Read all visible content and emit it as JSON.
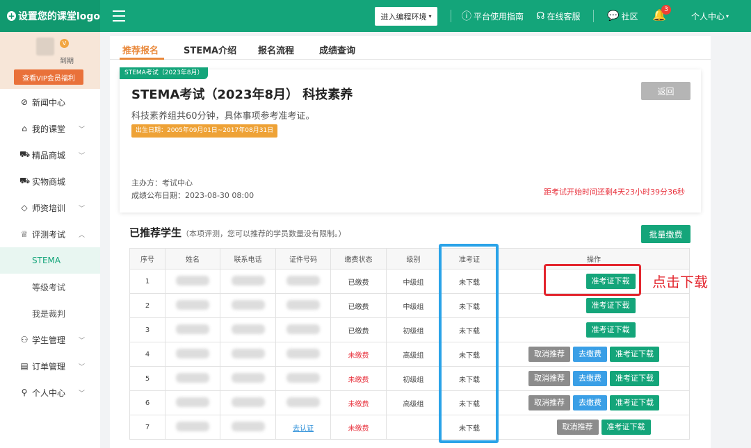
{
  "logo": {
    "text": "设置您的课堂logo"
  },
  "header": {
    "env_button": "进入编程环境",
    "guide": "平台使用指南",
    "service": "在线客服",
    "community": "社区",
    "notify_count": "3",
    "user_center": "个人中心"
  },
  "sidebar": {
    "expire_suffix": "到期",
    "vip_button": "查看VIP会员福利",
    "items": [
      {
        "label": "新闻中心",
        "icon": "compass-icon"
      },
      {
        "label": "我的课堂",
        "icon": "home-icon"
      },
      {
        "label": "精品商城",
        "icon": "cart-icon"
      },
      {
        "label": "实物商城",
        "icon": "cart-icon"
      },
      {
        "label": "师资培训",
        "icon": "graduation-icon"
      },
      {
        "label": "评测考试",
        "icon": "trophy-icon"
      },
      {
        "label": "STEMA"
      },
      {
        "label": "等级考试"
      },
      {
        "label": "我是裁判"
      },
      {
        "label": "学生管理",
        "icon": "users-icon"
      },
      {
        "label": "订单管理",
        "icon": "order-icon"
      },
      {
        "label": "个人中心",
        "icon": "user-icon"
      }
    ]
  },
  "tabs": [
    "推荐报名",
    "STEMA介绍",
    "报名流程",
    "成绩查询"
  ],
  "exam": {
    "tag": "STEMA考试（2023年8月）",
    "title": "STEMA考试（2023年8月） 科技素养",
    "back": "返回",
    "desc": "科技素养组共60分钟，具体事项参考准考证。",
    "birth_range": "出生日期：2005年09月01日~2017年08月31日",
    "organizer": "主办方：考试中心",
    "publish_date": "成绩公布日期：2023-08-30 08:00",
    "countdown": "距考试开始时间还剩4天23小时39分36秒"
  },
  "section": {
    "title": "已推荐学生",
    "note": "（本项评测，您可以推荐的学员数量没有限制。）",
    "batch_pay": "批量缴费"
  },
  "table": {
    "headers": [
      "序号",
      "姓名",
      "联系电话",
      "证件号码",
      "缴费状态",
      "级别",
      "准考证",
      "操作"
    ],
    "rows": [
      {
        "no": "1",
        "status": "已缴费",
        "level": "中级组",
        "ticket": "未下载"
      },
      {
        "no": "2",
        "status": "已缴费",
        "level": "中级组",
        "ticket": "未下载"
      },
      {
        "no": "3",
        "status": "已缴费",
        "level": "初级组",
        "ticket": "未下载"
      },
      {
        "no": "4",
        "status": "未缴费",
        "level": "高级组",
        "ticket": "未下载"
      },
      {
        "no": "5",
        "status": "未缴费",
        "level": "初级组",
        "ticket": "未下载"
      },
      {
        "no": "6",
        "status": "未缴费",
        "level": "高级组",
        "ticket": "未下载"
      },
      {
        "no": "7",
        "status": "未缴费",
        "level": "",
        "ticket": "未下载",
        "id_link": "去认证"
      }
    ],
    "btn_cancel": "取消推荐",
    "btn_pay": "去缴费",
    "btn_download": "准考证下载"
  },
  "annotation": {
    "text": "点击下载"
  },
  "colors": {
    "brand": "#14a57a",
    "accent": "#e9883a",
    "alert": "#e8333e",
    "annot_red": "#e3262e",
    "annot_blue": "#2aa3e8"
  }
}
